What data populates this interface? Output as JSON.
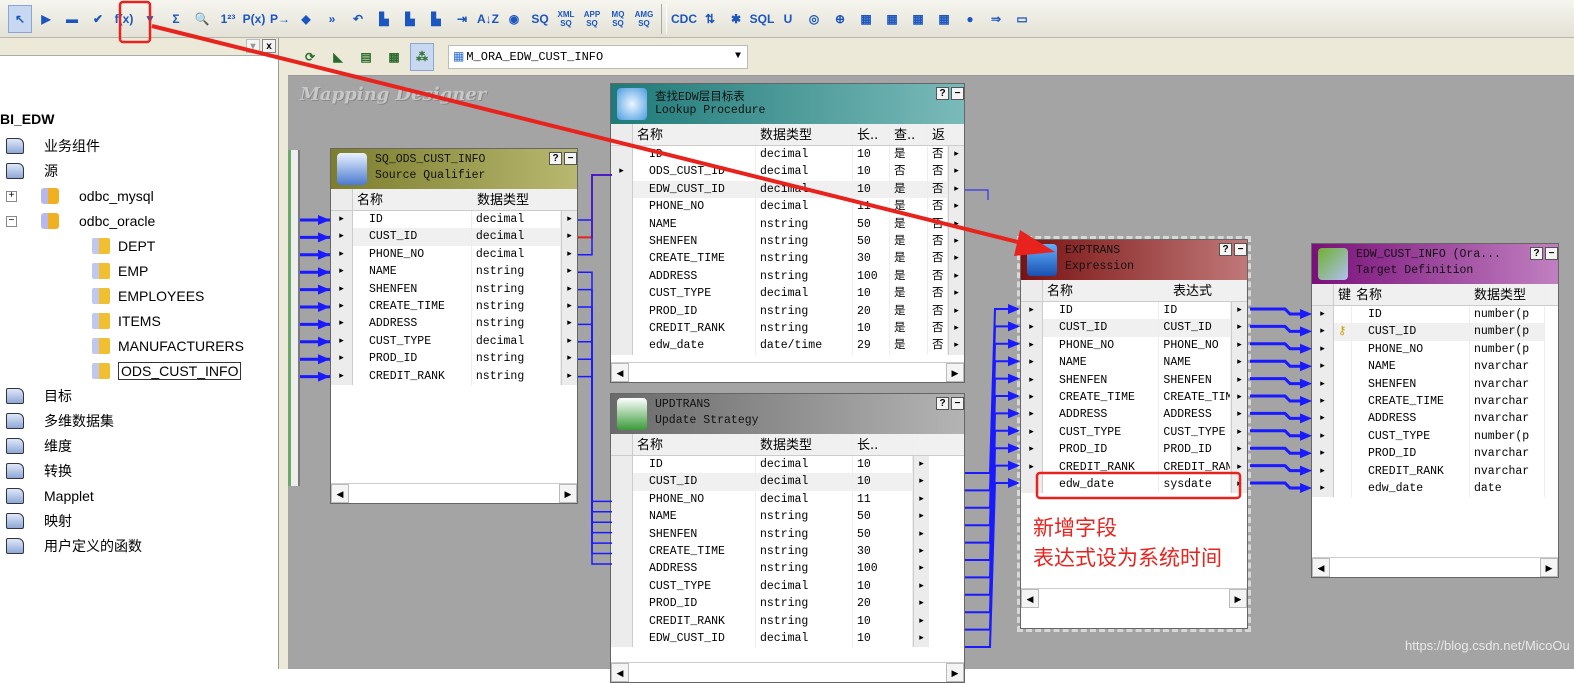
{
  "toolbar": {
    "icons": [
      {
        "name": "pointer",
        "glyph": "↖"
      },
      {
        "name": "arrange",
        "glyph": "▶"
      },
      {
        "name": "iconize",
        "glyph": "▬"
      },
      {
        "name": "validate",
        "glyph": "✔"
      },
      {
        "name": "expression",
        "glyph": "f(x)"
      },
      {
        "name": "filter",
        "glyph": "▼"
      },
      {
        "name": "aggregator",
        "glyph": "Σ"
      },
      {
        "name": "lookup",
        "glyph": "🔍"
      },
      {
        "name": "rank",
        "glyph": "1²³"
      },
      {
        "name": "stored-procedure",
        "glyph": "P(x)"
      },
      {
        "name": "xml",
        "glyph": "P→"
      },
      {
        "name": "joiner",
        "glyph": "◆"
      },
      {
        "name": "router",
        "glyph": "»"
      },
      {
        "name": "update-strategy",
        "glyph": "↶"
      },
      {
        "name": "normalizer",
        "glyph": "▙"
      },
      {
        "name": "sequence",
        "glyph": "▙"
      },
      {
        "name": "union",
        "glyph": "▙"
      },
      {
        "name": "transaction",
        "glyph": "⇥"
      },
      {
        "name": "sorter",
        "glyph": "A↓Z"
      },
      {
        "name": "mapplet",
        "glyph": "◉"
      },
      {
        "name": "source-qualifier",
        "glyph": "SQ"
      },
      {
        "name": "xml-sq",
        "glyph": "XML SQ"
      },
      {
        "name": "app-sq",
        "glyph": "APP SQ"
      },
      {
        "name": "mq-sq",
        "glyph": "MQ SQ"
      },
      {
        "name": "amg-sq",
        "glyph": "AMG SQ"
      },
      {
        "name": "cdc",
        "glyph": "CDC"
      },
      {
        "name": "key-gen",
        "glyph": "⇅"
      },
      {
        "name": "settings",
        "glyph": "✱"
      },
      {
        "name": "sql",
        "glyph": "SQL"
      },
      {
        "name": "unstructured",
        "glyph": "U"
      },
      {
        "name": "disk",
        "glyph": "◎"
      },
      {
        "name": "web",
        "glyph": "⊕"
      },
      {
        "name": "grid",
        "glyph": "▦"
      },
      {
        "name": "table",
        "glyph": "▦"
      },
      {
        "name": "matrix",
        "glyph": "▦"
      },
      {
        "name": "java",
        "glyph": "▦"
      },
      {
        "name": "globe",
        "glyph": "●"
      },
      {
        "name": "export",
        "glyph": "⇒"
      },
      {
        "name": "window",
        "glyph": "▭"
      }
    ]
  },
  "left_panel": {
    "close": "x",
    "dropdown": "▾",
    "tree": [
      {
        "label": "BI_EDW",
        "type": "root"
      },
      {
        "label": "业务组件",
        "type": "folder"
      },
      {
        "label": "源",
        "type": "folder"
      },
      {
        "label": "odbc_mysql",
        "type": "db",
        "expander": "+"
      },
      {
        "label": "odbc_oracle",
        "type": "db",
        "expander": "−"
      },
      {
        "label": "DEPT",
        "type": "table"
      },
      {
        "label": "EMP",
        "type": "table"
      },
      {
        "label": "EMPLOYEES",
        "type": "table"
      },
      {
        "label": "ITEMS",
        "type": "table"
      },
      {
        "label": "MANUFACTURERS",
        "type": "table"
      },
      {
        "label": "ODS_CUST_INFO",
        "type": "table",
        "selected": true
      },
      {
        "label": "目标",
        "type": "folder"
      },
      {
        "label": "多维数据集",
        "type": "folder"
      },
      {
        "label": "维度",
        "type": "folder"
      },
      {
        "label": "转换",
        "type": "folder"
      },
      {
        "label": "Mapplet",
        "type": "folder"
      },
      {
        "label": "映射",
        "type": "folder"
      },
      {
        "label": "用户定义的函数",
        "type": "folder"
      }
    ]
  },
  "designer_toolbar": {
    "icons": [
      "source-analyzer",
      "target-designer",
      "transformation-developer",
      "mapplet-designer",
      "mapping-designer"
    ],
    "mapping": "M_ORA_EDW_CUST_INFO"
  },
  "canvas": {
    "label": "Mapping Designer"
  },
  "transforms": {
    "sq": {
      "title": "SQ_ODS_CUST_INFO",
      "type": "Source Qualifier",
      "color": "#9a9a3e",
      "headers": [
        "名称",
        "数据类型"
      ],
      "rows": [
        [
          "ID",
          "decimal"
        ],
        [
          "CUST_ID",
          "decimal"
        ],
        [
          "PHONE_NO",
          "decimal"
        ],
        [
          "NAME",
          "nstring"
        ],
        [
          "SHENFEN",
          "nstring"
        ],
        [
          "CREATE_TIME",
          "nstring"
        ],
        [
          "ADDRESS",
          "nstring"
        ],
        [
          "CUST_TYPE",
          "decimal"
        ],
        [
          "PROD_ID",
          "nstring"
        ],
        [
          "CREDIT_RANK",
          "nstring"
        ]
      ]
    },
    "lookup": {
      "title": "查找EDW层目标表",
      "type": "Lookup Procedure",
      "color": "#2a8c8a",
      "headers": [
        "名称",
        "数据类型",
        "长..",
        "查..",
        "返"
      ],
      "rows": [
        [
          "ID",
          "decimal",
          "10",
          "是",
          "否"
        ],
        [
          "ODS_CUST_ID",
          "decimal",
          "10",
          "否",
          "否"
        ],
        [
          "EDW_CUST_ID",
          "decimal",
          "10",
          "是",
          "否"
        ],
        [
          "PHONE_NO",
          "decimal",
          "11",
          "是",
          "否"
        ],
        [
          "NAME",
          "nstring",
          "50",
          "是",
          "否"
        ],
        [
          "SHENFEN",
          "nstring",
          "50",
          "是",
          "否"
        ],
        [
          "CREATE_TIME",
          "nstring",
          "30",
          "是",
          "否"
        ],
        [
          "ADDRESS",
          "nstring",
          "100",
          "是",
          "否"
        ],
        [
          "CUST_TYPE",
          "decimal",
          "10",
          "是",
          "否"
        ],
        [
          "PROD_ID",
          "nstring",
          "20",
          "是",
          "否"
        ],
        [
          "CREDIT_RANK",
          "nstring",
          "10",
          "是",
          "否"
        ],
        [
          "edw_date",
          "date/time",
          "29",
          "是",
          "否"
        ]
      ]
    },
    "update": {
      "title": "UPDTRANS",
      "type": "Update Strategy",
      "color": "#8a8a8a",
      "headers": [
        "名称",
        "数据类型",
        "长.."
      ],
      "rows": [
        [
          "ID",
          "decimal",
          "10"
        ],
        [
          "CUST_ID",
          "decimal",
          "10"
        ],
        [
          "PHONE_NO",
          "decimal",
          "11"
        ],
        [
          "NAME",
          "nstring",
          "50"
        ],
        [
          "SHENFEN",
          "nstring",
          "50"
        ],
        [
          "CREATE_TIME",
          "nstring",
          "30"
        ],
        [
          "ADDRESS",
          "nstring",
          "100"
        ],
        [
          "CUST_TYPE",
          "decimal",
          "10"
        ],
        [
          "PROD_ID",
          "nstring",
          "20"
        ],
        [
          "CREDIT_RANK",
          "nstring",
          "10"
        ],
        [
          "EDW_CUST_ID",
          "decimal",
          "10"
        ]
      ]
    },
    "expression": {
      "title": "EXPTRANS",
      "type": "Expression",
      "color": "#8a1c1c",
      "headers": [
        "名称",
        "表达式"
      ],
      "rows": [
        [
          "ID",
          "ID"
        ],
        [
          "CUST_ID",
          "CUST_ID"
        ],
        [
          "PHONE_NO",
          "PHONE_NO"
        ],
        [
          "NAME",
          "NAME"
        ],
        [
          "SHENFEN",
          "SHENFEN"
        ],
        [
          "CREATE_TIME",
          "CREATE_TIME"
        ],
        [
          "ADDRESS",
          "ADDRESS"
        ],
        [
          "CUST_TYPE",
          "CUST_TYPE"
        ],
        [
          "PROD_ID",
          "PROD_ID"
        ],
        [
          "CREDIT_RANK",
          "CREDIT_RANK"
        ],
        [
          "edw_date",
          "sysdate"
        ]
      ]
    },
    "target": {
      "title": "EDW_CUST_INFO (Ora...",
      "type": "Target Definition",
      "color": "#8a1c8c",
      "headers": [
        "键",
        "名称",
        "数据类型"
      ],
      "rows": [
        [
          "",
          "ID",
          "number(p"
        ],
        [
          "key",
          "CUST_ID",
          "number(p"
        ],
        [
          "",
          "PHONE_NO",
          "number(p"
        ],
        [
          "",
          "NAME",
          "nvarchar"
        ],
        [
          "",
          "SHENFEN",
          "nvarchar"
        ],
        [
          "",
          "CREATE_TIME",
          "nvarchar"
        ],
        [
          "",
          "ADDRESS",
          "nvarchar"
        ],
        [
          "",
          "CUST_TYPE",
          "number(p"
        ],
        [
          "",
          "PROD_ID",
          "nvarchar"
        ],
        [
          "",
          "CREDIT_RANK",
          "nvarchar"
        ],
        [
          "",
          "edw_date",
          "date"
        ]
      ]
    }
  },
  "annotation": {
    "line1": "新增字段",
    "line2": "表达式设为系统时间",
    "color": "#e8231d"
  },
  "watermark": "https://blog.csdn.net/MicoOu",
  "colors": {
    "link": "#1a1aff",
    "annotation": "#e8231d"
  }
}
